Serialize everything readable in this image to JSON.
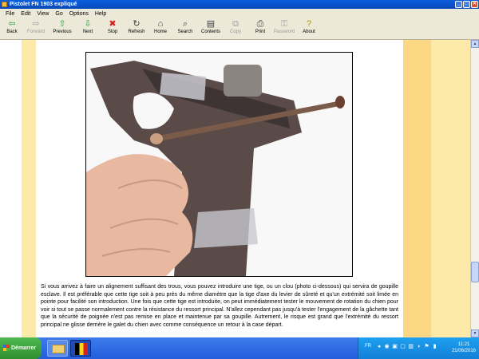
{
  "window": {
    "title": "Pistolet FN 1903 expliqué"
  },
  "menu": [
    "File",
    "Edit",
    "View",
    "Go",
    "Options",
    "Help"
  ],
  "toolbar": [
    {
      "label": "Back",
      "icon": "back-arrow-icon",
      "glyph": "⇦",
      "color": "#2a9a40",
      "enabled": true
    },
    {
      "label": "Forward",
      "icon": "forward-arrow-icon",
      "glyph": "⇨",
      "color": "#a0a0a0",
      "enabled": false
    },
    {
      "label": "Previous",
      "icon": "up-arrow-icon",
      "glyph": "⇧",
      "color": "#2aa040",
      "enabled": true
    },
    {
      "label": "Next",
      "icon": "down-arrow-icon",
      "glyph": "⇩",
      "color": "#2aa040",
      "enabled": true
    },
    {
      "label": "Stop",
      "icon": "stop-icon",
      "glyph": "✖",
      "color": "#d82020",
      "enabled": true
    },
    {
      "label": "Refresh",
      "icon": "refresh-icon",
      "glyph": "↻",
      "color": "#404040",
      "enabled": true
    },
    {
      "label": "Home",
      "icon": "home-icon",
      "glyph": "⌂",
      "color": "#404040",
      "enabled": true
    },
    {
      "label": "Search",
      "icon": "search-icon",
      "glyph": "⌕",
      "color": "#404040",
      "enabled": true
    },
    {
      "label": "Contents",
      "icon": "contents-icon",
      "glyph": "▤",
      "color": "#404040",
      "enabled": true
    },
    {
      "label": "Copy",
      "icon": "copy-icon",
      "glyph": "⧉",
      "color": "#a0a0a0",
      "enabled": false
    },
    {
      "label": "Print",
      "icon": "print-icon",
      "glyph": "⎙",
      "color": "#404040",
      "enabled": true
    },
    {
      "label": "Password",
      "icon": "key-icon",
      "glyph": "⚿",
      "color": "#a0a0a0",
      "enabled": false
    },
    {
      "label": "About",
      "icon": "about-icon",
      "glyph": "?",
      "color": "#c89000",
      "enabled": true
    }
  ],
  "content": {
    "photo_alt": "pistol-disassembly-photo",
    "paragraph": "Si vous arrivez à faire un alignement suffisant des trous, vous pouvez introduire une tige, ou un clou (photo ci-dessous) qui servira de goupille esclave. Il est préférable que cette tige soit à peu près du même diamètre que la tige d'axe du levier de sûreté et qu'un extrémité soit limée en pointe pour facilité son introduction. Une fois que cette tige est introduite, on peut immédiatement tester le mouvement de rotation du chien pour voir si tout se passe normalement contre la résistance du ressort principal. N'allez cependant pas jusqu'à tester l'engagement de la gâchette tant que la sécurité de poignée n'est pas remise en place et maintenue par sa goupille. Autrement, le risque est grand que l'extrémité du ressort principal ne glisse derrière le galet du chien avec comme conséquence un retour à la case départ."
  },
  "taskbar": {
    "start_label": "Démarrer",
    "language": "FR",
    "time": "11:21",
    "date": "21/06/2016"
  },
  "colors": {
    "titlebar": "#0a5fe0",
    "band_light": "#fde9a8",
    "band_dark": "#fdd884",
    "taskbar": "#245edc",
    "start": "#3ea83e"
  }
}
